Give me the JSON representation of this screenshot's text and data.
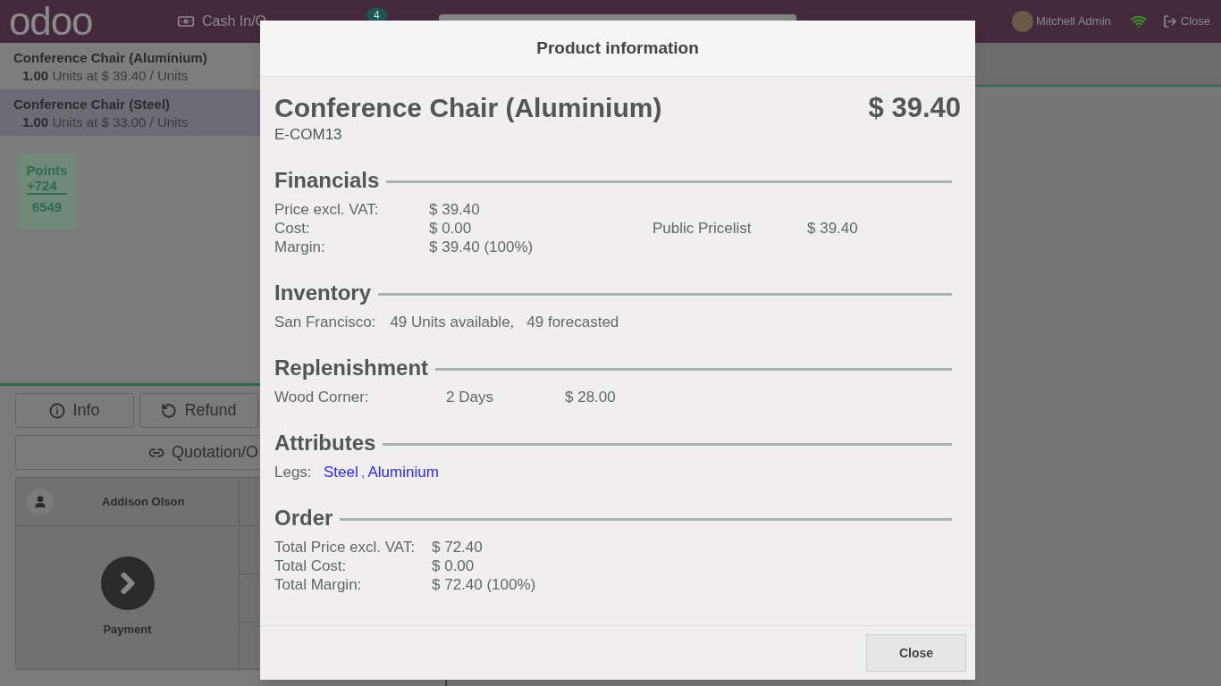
{
  "header": {
    "logo": "odoo",
    "cash": "Cash In/O",
    "orders": {
      "count": "4"
    },
    "user": "Mitchell Admin",
    "close": "Close"
  },
  "order_lines": [
    {
      "name": "Conference Chair (Aluminium)",
      "quantity": "1.00",
      "detail": "Units at $ 39.40 / Units",
      "selected": false
    },
    {
      "name": "Conference Chair (Steel)",
      "quantity": "1.00",
      "detail": "Units at $ 33.00 / Units",
      "selected": true
    }
  ],
  "loyalty": {
    "label": "Points",
    "added": "+724",
    "total": "6549"
  },
  "control_buttons": [
    {
      "kind": "info",
      "label": "Info"
    },
    {
      "kind": "refund",
      "label": "Refund"
    },
    {
      "kind": "quotation",
      "label": "Quotation/O"
    }
  ],
  "actionpad": {
    "customer": "Addison Olson",
    "payment": "Payment"
  },
  "modal": {
    "title": "Product information",
    "product": {
      "name": "Conference Chair (Aluminium)",
      "code": "E-COM13",
      "price": "$ 39.40"
    },
    "financials": {
      "title": "Financials",
      "rows": [
        {
          "label": "Price excl. VAT:",
          "value": "$ 39.40"
        },
        {
          "label": "Cost:",
          "value": "$ 0.00"
        },
        {
          "label": "Margin:",
          "value": "$ 39.40 (100%)"
        }
      ],
      "pricelists": [
        {
          "name": "Public Pricelist",
          "value": "$ 39.40"
        }
      ]
    },
    "inventory": {
      "title": "Inventory",
      "rows": [
        {
          "warehouse": "San Francisco:",
          "available": "49 Units available,",
          "forecasted": "49 forecasted"
        }
      ]
    },
    "replenishment": {
      "title": "Replenishment",
      "rows": [
        {
          "vendor": "Wood Corner:",
          "delay": "2 Days",
          "price": "$ 28.00"
        }
      ]
    },
    "attributes": {
      "title": "Attributes",
      "rows": [
        {
          "name": "Legs:",
          "separator": ",",
          "values": [
            "Steel",
            "Aluminium"
          ]
        }
      ]
    },
    "order": {
      "title": "Order",
      "rows": [
        {
          "label": "Total Price excl. VAT:",
          "value": "$ 72.40"
        },
        {
          "label": "Total Cost:",
          "value": "$ 0.00"
        },
        {
          "label": "Total Margin:",
          "value": "$ 72.40 (100%)"
        }
      ]
    },
    "close_button": "Close"
  }
}
